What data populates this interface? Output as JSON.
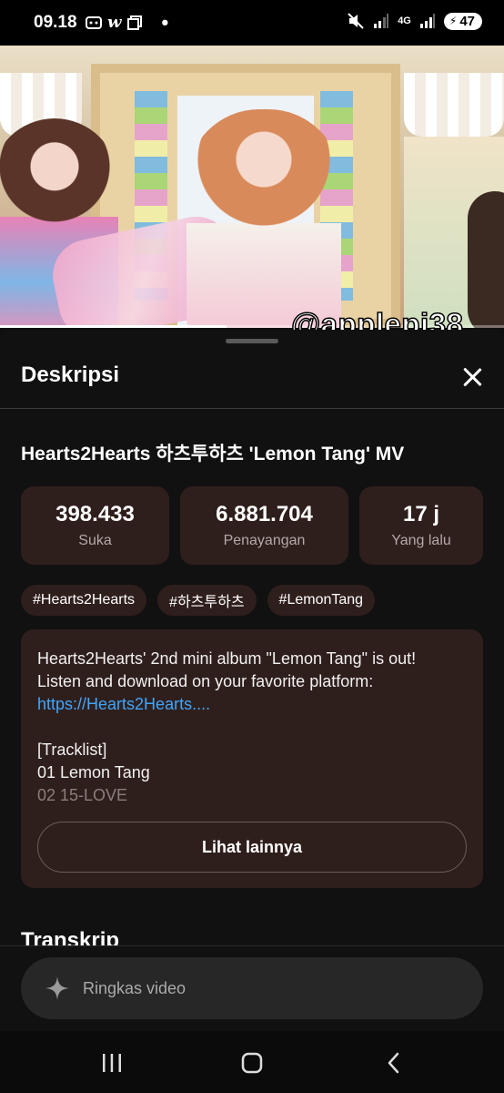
{
  "status_bar": {
    "time": "09.18",
    "battery": "47",
    "network": "4G",
    "icons": [
      "screen-capture-icon",
      "w-app-icon",
      "copy-icon",
      "notification-dot-icon",
      "mute-icon",
      "signal-icon",
      "signal-4g-icon",
      "signal-icon-2",
      "battery-icon"
    ]
  },
  "video": {
    "watermark": "@applepi38",
    "progress": 0.45
  },
  "description_sheet": {
    "title": "Deskripsi",
    "close_icon": "close-icon",
    "video_title": "Hearts2Hearts 하츠투하츠 'Lemon Tang' MV",
    "stats": [
      {
        "value": "398.433",
        "label": "Suka"
      },
      {
        "value": "6.881.704",
        "label": "Penayangan"
      },
      {
        "value": "17 j",
        "label": "Yang lalu"
      }
    ],
    "tags": [
      "#Hearts2Hearts",
      "#하츠투하츠",
      "#LemonTang"
    ],
    "description": {
      "line1": "Hearts2Hearts' 2nd mini album \"Lemon Tang\" is out!",
      "line2": "Listen and download on your favorite platform:",
      "link": "https://Hearts2Hearts....",
      "line4": "[Tracklist]",
      "line5": "01 Lemon Tang",
      "line6": "02 15-LOVE"
    },
    "show_more_label": "Lihat lainnya",
    "next_section": "Transkrip"
  },
  "bottom_input": {
    "icon": "sparkle-icon",
    "label": "Ringkas video"
  },
  "nav_bar": {
    "buttons": [
      "recent-apps-icon",
      "home-icon",
      "back-icon"
    ]
  },
  "colors": {
    "background": "#0f0f0f",
    "card": "#2f1f1c",
    "link": "#3ea6ff",
    "muted_text": "#b3a9a6"
  }
}
